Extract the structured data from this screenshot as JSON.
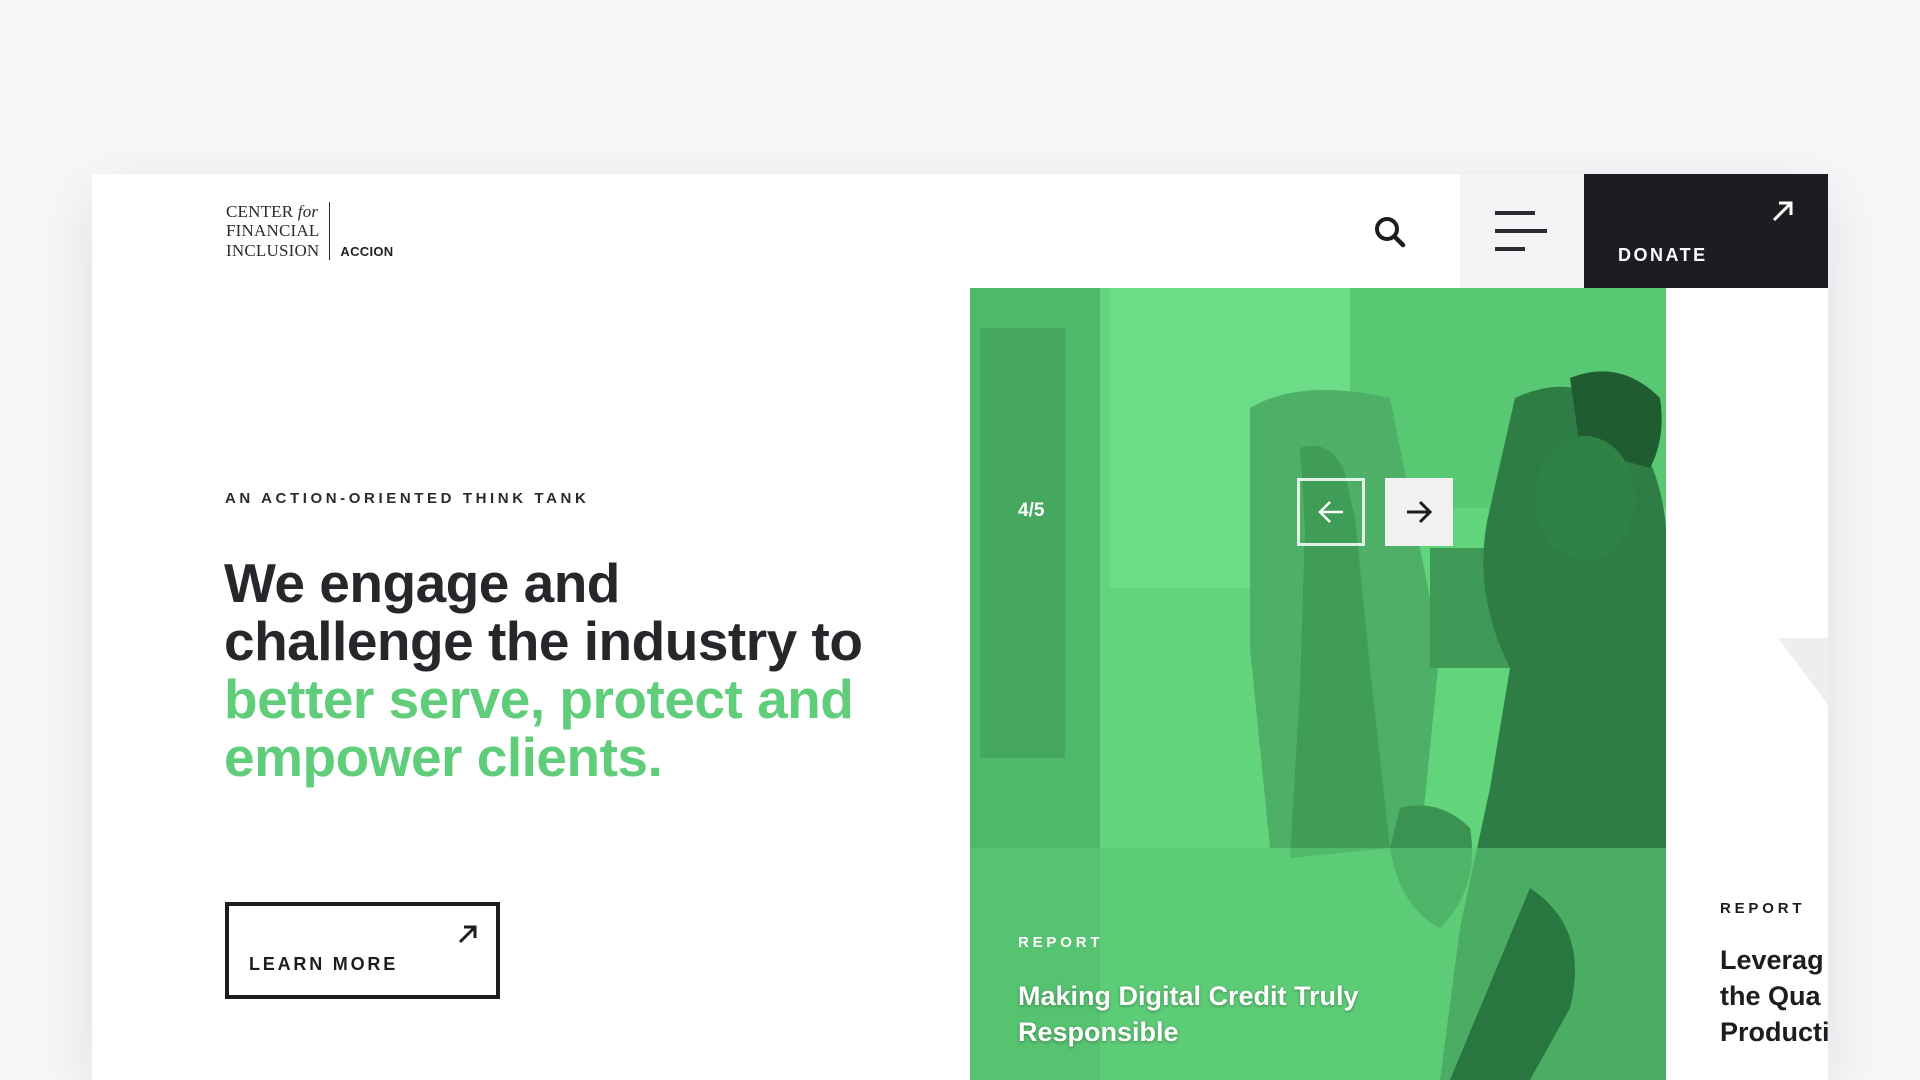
{
  "header": {
    "logo": {
      "line1": "CENTER",
      "line1_italic": "for",
      "line2": "FINANCIAL",
      "line3": "INCLUSION",
      "partner": "ACCION"
    },
    "search_icon": "search-icon",
    "menu_icon": "hamburger-menu-icon",
    "donate_label": "DONATE",
    "donate_icon": "arrow-up-right-icon"
  },
  "hero": {
    "eyebrow": "AN ACTION-ORIENTED THINK TANK",
    "headline_plain": "We engage and challenge the industry to ",
    "headline_accent": "better serve, protect and empower clients.",
    "cta_label": "LEARN MORE",
    "cta_icon": "arrow-up-right-icon"
  },
  "carousel": {
    "counter": "4/5",
    "prev_icon": "arrow-left-icon",
    "next_icon": "arrow-right-icon",
    "current": {
      "kicker": "REPORT",
      "title": "Making Digital Credit Truly Responsible"
    },
    "next": {
      "kicker": "REPORT",
      "title": "Leverag\nthe Qua\nProducti"
    }
  },
  "colors": {
    "accent_green": "#5fcd7a",
    "dark": "#1c1d21",
    "background": "#f6f7f9"
  }
}
